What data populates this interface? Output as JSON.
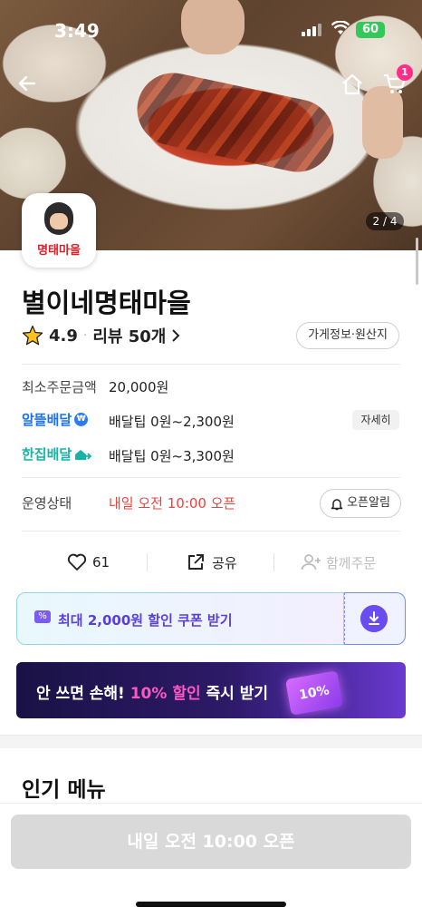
{
  "status_bar": {
    "time": "3:49",
    "battery": "60"
  },
  "header": {
    "cart_count": "1",
    "photo_counter": "2 / 4"
  },
  "store": {
    "logo_text": "명태마을",
    "name": "별이네명태마을",
    "rating": "4.9",
    "review_label": "리뷰 50개",
    "info_button": "가게정보·원산지"
  },
  "order_info": {
    "min_order_label": "최소주문금액",
    "min_order_value": "20,000원",
    "alddeul_label": "알뜰배달",
    "alddeul_tip": "배달팁 0원~2,300원",
    "detail_button": "자세히",
    "hanjip_label": "한집배달",
    "hanjip_tip": "배달팁 0원~3,300원"
  },
  "operation": {
    "label": "운영상태",
    "status": "내일 오전 10:00 오픈",
    "alarm_button": "오픈알림"
  },
  "actions": {
    "like_count": "61",
    "share_label": "공유",
    "group_order_label": "함께주문"
  },
  "coupon": {
    "text": "최대 2,000원 할인 쿠폰 받기"
  },
  "promo_banner": {
    "text_before": "안 쓰면 손해! ",
    "pct": "10% 할인",
    "text_after": " 즉시 받기",
    "ticket_label": "10%"
  },
  "menu_section": {
    "title": "인기 메뉴"
  },
  "bottom_cta": {
    "label": "내일 오전 10:00 오픈"
  },
  "colors": {
    "accent_purple": "#6a4df0",
    "open_status_red": "#f0413a",
    "alddeul_blue": "#1a73e8",
    "hanjip_teal": "#16b3a6"
  }
}
